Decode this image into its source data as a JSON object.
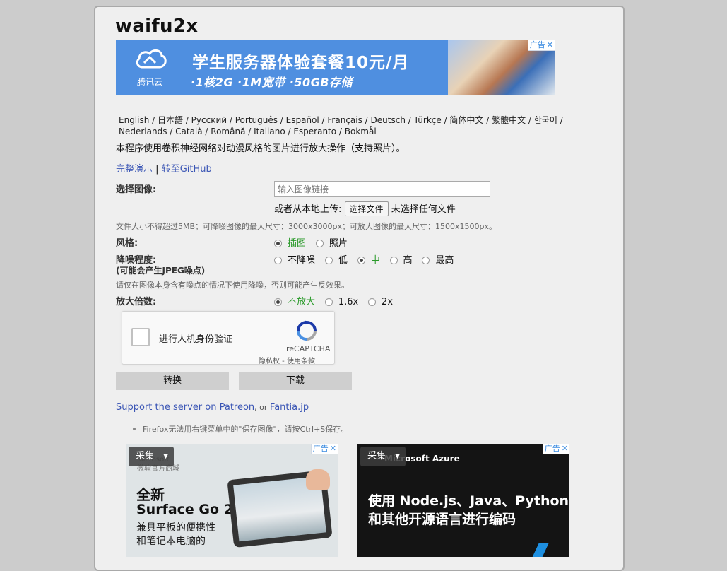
{
  "app": {
    "title": "waifu2x"
  },
  "banner_ad": {
    "brand": "腾讯云",
    "headline": "学生服务器体验套餐10元/月",
    "subline": "·1核2G  ·1M宽带  ·50GB存储",
    "ad_tag": "广告",
    "close": "✕"
  },
  "languages": "English / 日本語 / Русский / Português / Español / Français / Deutsch / Türkçe / 简体中文 / 繁體中文 / 한국어 / Nederlands / Català / Română / Italiano / Esperanto / Bokmål",
  "description": "本程序使用卷积神经网络对动漫风格的图片进行放大操作（支持照片）。",
  "links": {
    "demo": "完整演示",
    "sep": "|",
    "github": "转至GitHub"
  },
  "form": {
    "select_image_label": "选择图像:",
    "url_placeholder": "输入图像链接",
    "local_upload_label": "或者从本地上传:",
    "file_button": "选择文件",
    "no_file": "未选择任何文件",
    "size_hint": "文件大小不得超过5MB；可降噪图像的最大尺寸：3000x3000px；可放大图像的最大尺寸：1500x1500px。",
    "style_label": "风格:",
    "style_options": [
      "插图",
      "照片"
    ],
    "style_selected": "插图",
    "noise_label": "降噪程度:",
    "noise_sublabel": "(可能会产生JPEG噪点)",
    "noise_options": [
      "不降噪",
      "低",
      "中",
      "高",
      "最高"
    ],
    "noise_selected": "中",
    "noise_hint": "请仅在图像本身含有噪点的情况下使用降噪，否则可能产生反效果。",
    "scale_label": "放大倍数:",
    "scale_options": [
      "不放大",
      "1.6x",
      "2x"
    ],
    "scale_selected": "不放大",
    "convert_button": "转换",
    "download_button": "下载"
  },
  "captcha": {
    "label": "进行人机身份验证",
    "brand": "reCAPTCHA",
    "terms": "隐私权 - 使用条款"
  },
  "support": {
    "text": "Support the server on Patreon",
    "or": ", or ",
    "fantia": "Fantia.jp"
  },
  "note": "Firefox无法用右键菜单中的\"保存图像\"，请按Ctrl+S保存。",
  "ad_left": {
    "collect": "采集",
    "brand": "Microsoft\n微软官方商城",
    "headline1": "全新",
    "headline2": "Surface Go 2",
    "body": "兼具平板的便携性\n和笔记本电脑的",
    "ad_tag": "广告"
  },
  "ad_right": {
    "collect": "采集",
    "brand": "Microsoft Azure",
    "headline1": "使用 Node.js、Java、Python",
    "headline2": "和其他开源语言进行编码",
    "ad_tag": "广告"
  }
}
